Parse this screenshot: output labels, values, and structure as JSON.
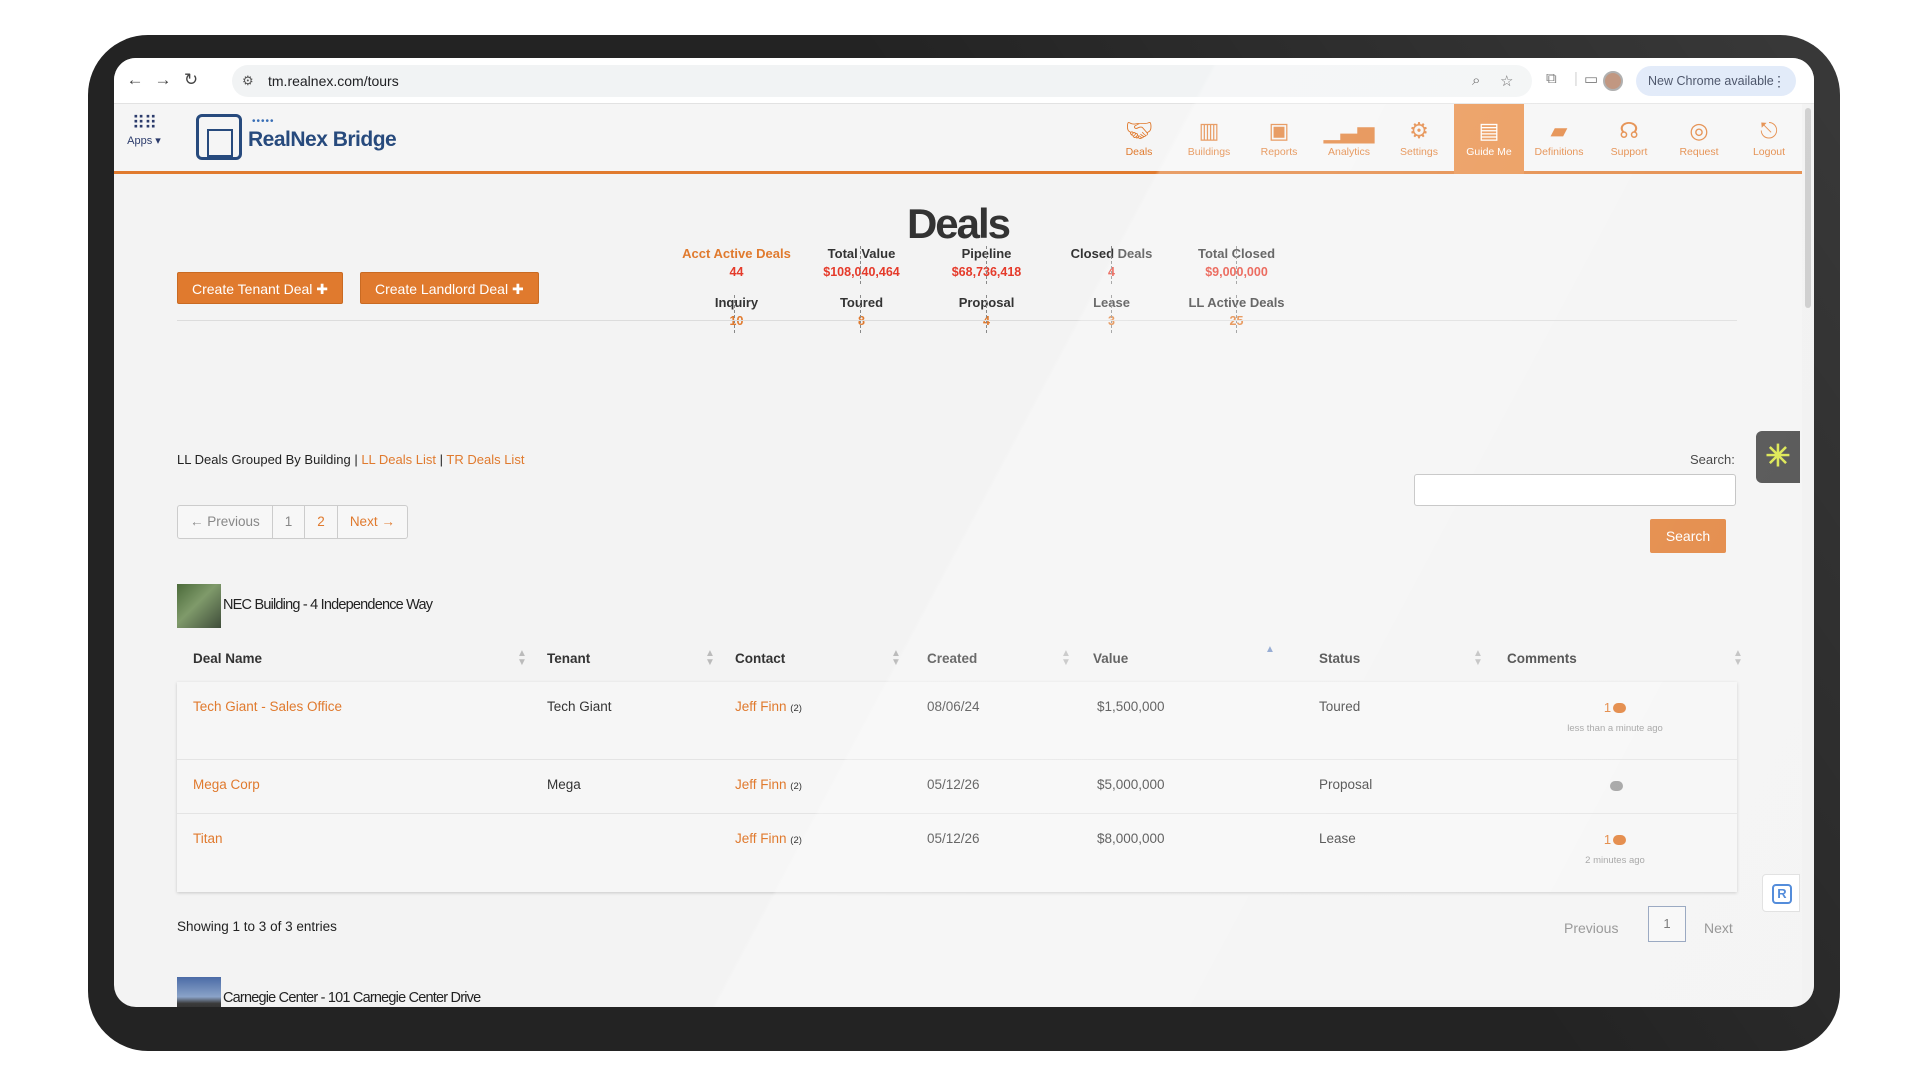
{
  "browser": {
    "url": "tm.realnex.com/tours",
    "update_label": "New Chrome available"
  },
  "header": {
    "apps_label": "Apps",
    "logo_text": "RealNex Bridge",
    "nav": [
      {
        "label": "Deals",
        "icon": "handshake-icon"
      },
      {
        "label": "Buildings",
        "icon": "building-icon"
      },
      {
        "label": "Reports",
        "icon": "image-report-icon"
      },
      {
        "label": "Analytics",
        "icon": "bar-chart-icon"
      },
      {
        "label": "Settings",
        "icon": "gear-icon"
      },
      {
        "label": "Guide Me",
        "icon": "guide-icon",
        "active": true
      },
      {
        "label": "Definitions",
        "icon": "book-icon"
      },
      {
        "label": "Support",
        "icon": "headset-icon"
      },
      {
        "label": "Request",
        "icon": "lightbulb-icon"
      },
      {
        "label": "Logout",
        "icon": "logout-icon"
      }
    ]
  },
  "page": {
    "title": "Deals",
    "create_tenant": "Create Tenant Deal",
    "create_landlord": "Create Landlord Deal"
  },
  "stats": {
    "row1": [
      {
        "label": "Acct Active Deals",
        "value": "44"
      },
      {
        "label": "Total Value",
        "value": "$108,040,464"
      },
      {
        "label": "Pipeline",
        "value": "$68,736,418"
      },
      {
        "label": "Closed Deals",
        "value": "4"
      },
      {
        "label": "Total Closed",
        "value": "$9,000,000"
      }
    ],
    "row2": [
      {
        "label": "Inquiry",
        "value": "10"
      },
      {
        "label": "Toured",
        "value": "8"
      },
      {
        "label": "Proposal",
        "value": "4"
      },
      {
        "label": "Lease",
        "value": "3"
      },
      {
        "label": "LL Active Deals",
        "value": "25"
      }
    ]
  },
  "grouping": {
    "current": "LL Deals Grouped By Building",
    "sep": "|",
    "ll_link": "LL Deals List",
    "tr_link": "TR Deals List"
  },
  "search": {
    "label": "Search:",
    "button": "Search",
    "value": ""
  },
  "pager": {
    "prev": "← Previous",
    "pages": [
      "1",
      "2"
    ],
    "next": "Next →"
  },
  "buildings": [
    {
      "name": "NEC Building - 4 Independence Way"
    },
    {
      "name": "Carnegie Center - 101 Carnegie Center Drive"
    }
  ],
  "table": {
    "columns": [
      "Deal Name",
      "Tenant",
      "Contact",
      "Created",
      "Value",
      "Status",
      "Comments"
    ],
    "rows": [
      {
        "deal": "Tech Giant - Sales Office",
        "tenant": "Tech Giant",
        "contact": "Jeff Finn",
        "contact_count": "(2)",
        "created": "08/06/24",
        "value": "$1,500,000",
        "status": "Toured",
        "comments": "1",
        "ago": "less than a minute ago"
      },
      {
        "deal": "Mega Corp",
        "tenant": "Mega",
        "contact": "Jeff Finn",
        "contact_count": "(2)",
        "created": "05/12/26",
        "value": "$5,000,000",
        "status": "Proposal",
        "comments": "",
        "ago": ""
      },
      {
        "deal": "Titan",
        "tenant": "",
        "contact": "Jeff Finn",
        "contact_count": "(2)",
        "created": "05/12/26",
        "value": "$8,000,000",
        "status": "Lease",
        "comments": "1",
        "ago": "2 minutes ago"
      }
    ],
    "showing": "Showing 1 to 3 of 3 entries",
    "prev": "Previous",
    "page": "1",
    "next": "Next"
  },
  "colors": {
    "accent": "#e07a2e",
    "value_red": "#e53a2a",
    "brand_navy": "#274a7d"
  }
}
